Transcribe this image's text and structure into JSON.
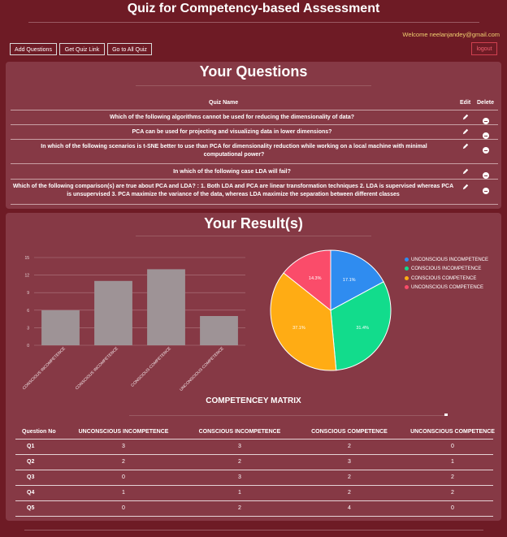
{
  "app": {
    "title": "Quiz for Competency-based Assessment",
    "welcome": "Welcome neelanjandey@gmail.com",
    "logout_label": "logout"
  },
  "nav": {
    "add_questions": "Add Questions",
    "get_quiz_link": "Get Quiz Link",
    "go_to_all_quiz": "Go to All Quiz"
  },
  "questions": {
    "section_title": "Your Questions",
    "headers": {
      "name": "Quiz Name",
      "edit": "Edit",
      "delete": "Delete"
    },
    "rows": [
      {
        "text": "Which of the following algorithms cannot be used for reducing the dimensionality of data?"
      },
      {
        "text": "PCA can be used for projecting and visualizing data in lower dimensions?"
      },
      {
        "text": "In which of the following scenarios is t-SNE better to use than PCA for dimensionality reduction while working on a local machine with minimal computational power?"
      },
      {
        "text": "In which of the following case LDA will fail?"
      },
      {
        "text": "Which of the following comparison(s) are true about PCA and LDA? : 1. Both LDA and PCA are linear transformation techniques 2. LDA is supervised whereas PCA is unsupervised 3. PCA maximize the variance of the data, whereas LDA maximize the separation between different classes"
      }
    ]
  },
  "results": {
    "section_title": "Your Result(s)"
  },
  "chart_data": [
    {
      "type": "bar",
      "categories": [
        "UNCONSCIOUS INCOMPETENCE",
        "CONSCIOUS INCOMPETENCE",
        "CONSCIOUS COMPETENCE",
        "UNCONSCIOUS COMPETENCE"
      ],
      "category_labels": [
        "CONSCIOUS INCOMPETENCE",
        "CONSCIOUS INCOMPETENCE",
        "CONSCIOUS COMPETENCE",
        "UNCONSCIOUS COMPETENCE"
      ],
      "values": [
        6,
        11,
        13,
        5
      ],
      "yticks": [
        0,
        3,
        6,
        9,
        12,
        15
      ],
      "ylim": [
        0,
        15
      ],
      "grid": true,
      "bar_color": "#9e9396"
    },
    {
      "type": "pie",
      "labels": [
        "UNCONSCIOUS INCOMPETENCE",
        "CONSCIOUS INCOMPETENCE",
        "CONSCIOUS COMPETENCE",
        "UNCONSCIOUS COMPETENCE"
      ],
      "values": [
        17.1,
        31.4,
        37.1,
        14.3
      ],
      "value_labels": [
        "17.1%",
        "31.4%",
        "37.1%",
        "14.3%"
      ],
      "colors": [
        "#2f8cf0",
        "#12dc8c",
        "#ffac14",
        "#fa4c6a"
      ],
      "legend": "right"
    }
  ],
  "matrix": {
    "title": "COMPETENCEY MATRIX",
    "headers": [
      "Question No",
      "UNCONSCIOUS INCOMPETENCE",
      "CONSCIOUS INCOMPETENCE",
      "CONSCIOUS COMPETENCE",
      "UNCONSCIOUS COMPETENCE"
    ],
    "rows": [
      [
        "Q1",
        "3",
        "3",
        "2",
        "0"
      ],
      [
        "Q2",
        "2",
        "2",
        "3",
        "1"
      ],
      [
        "Q3",
        "0",
        "3",
        "2",
        "2"
      ],
      [
        "Q4",
        "1",
        "1",
        "2",
        "2"
      ],
      [
        "Q5",
        "0",
        "2",
        "4",
        "0"
      ]
    ]
  }
}
